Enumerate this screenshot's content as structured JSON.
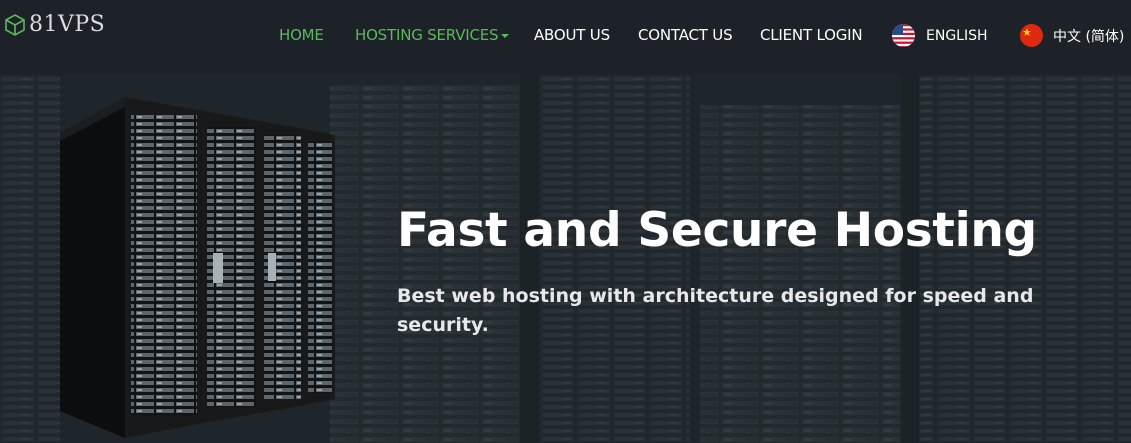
{
  "header": {
    "logo_text": "81VPS",
    "logo_icon": "cube-icon",
    "nav": [
      {
        "label": "HOME",
        "active": true
      },
      {
        "label": "HOSTING SERVICES",
        "active": true,
        "has_dropdown": true
      },
      {
        "label": "ABOUT US",
        "active": false
      },
      {
        "label": "CONTACT US",
        "active": false
      },
      {
        "label": "CLIENT LOGIN",
        "active": false
      }
    ],
    "languages": [
      {
        "label": "ENGLISH",
        "flag": "us-flag-icon"
      },
      {
        "label": "中文 (简体)",
        "flag": "china-flag-icon"
      }
    ]
  },
  "hero": {
    "title": "Fast and Secure Hosting",
    "subtitle": "Best web hosting with architecture designed for speed and security."
  },
  "colors": {
    "accent": "#5cb85c",
    "header_bg": "#1c2227",
    "text": "#ffffff"
  }
}
